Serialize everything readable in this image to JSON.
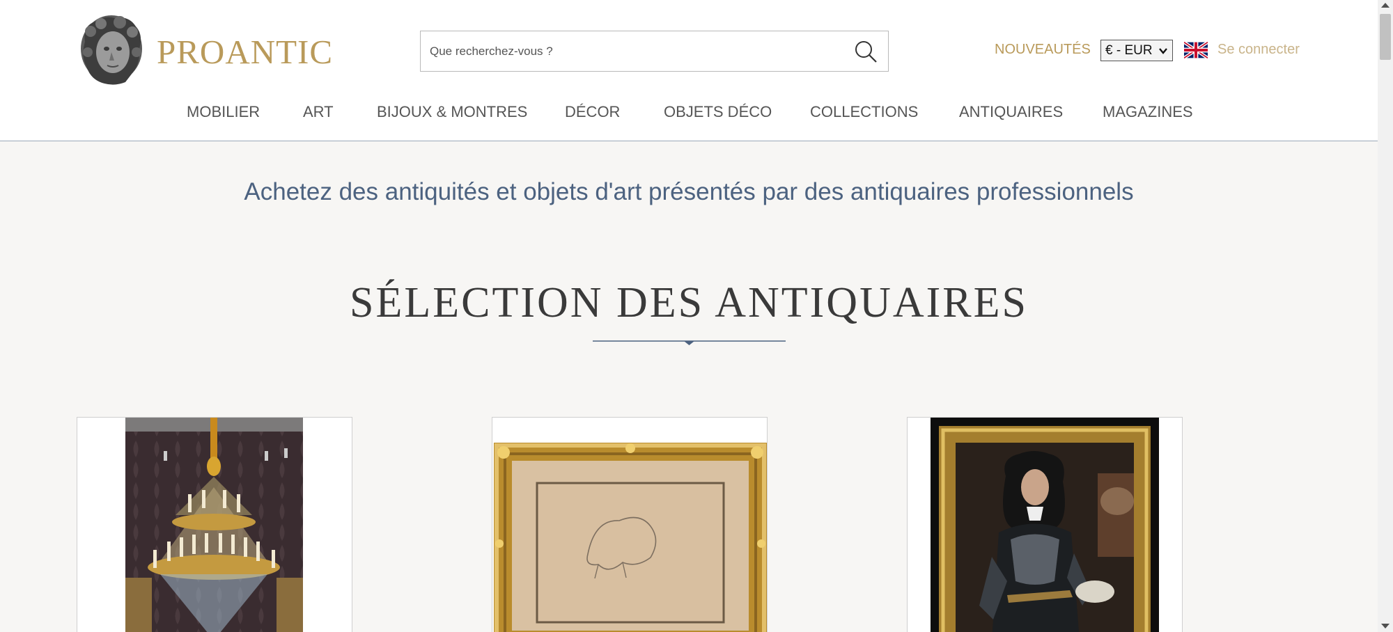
{
  "header": {
    "brand": "PROANTIC",
    "search": {
      "placeholder": "Que recherchez-vous ?"
    },
    "new_label": "NOUVEAUTÉS",
    "currency": "€ - EUR",
    "login_label": "Se connecter"
  },
  "nav": {
    "items": [
      {
        "label": "MOBILIER"
      },
      {
        "label": "ART"
      },
      {
        "label": "BIJOUX & MONTRES"
      },
      {
        "label": "DÉCOR"
      },
      {
        "label": "OBJETS DÉCO"
      },
      {
        "label": "COLLECTIONS"
      },
      {
        "label": "ANTIQUAIRES"
      },
      {
        "label": "MAGAZINES"
      }
    ]
  },
  "main": {
    "tagline": "Achetez des antiquités et objets d'art présentés par des antiquaires professionnels",
    "section_title": "SÉLECTION DES ANTIQUAIRES"
  },
  "products": [
    {
      "icon": "chandelier-image"
    },
    {
      "icon": "framed-drawing-image"
    },
    {
      "icon": "portrait-painting-image"
    }
  ],
  "colors": {
    "accent": "#b99a5a",
    "tagline": "#4c6280",
    "background": "#f7f6f4"
  }
}
